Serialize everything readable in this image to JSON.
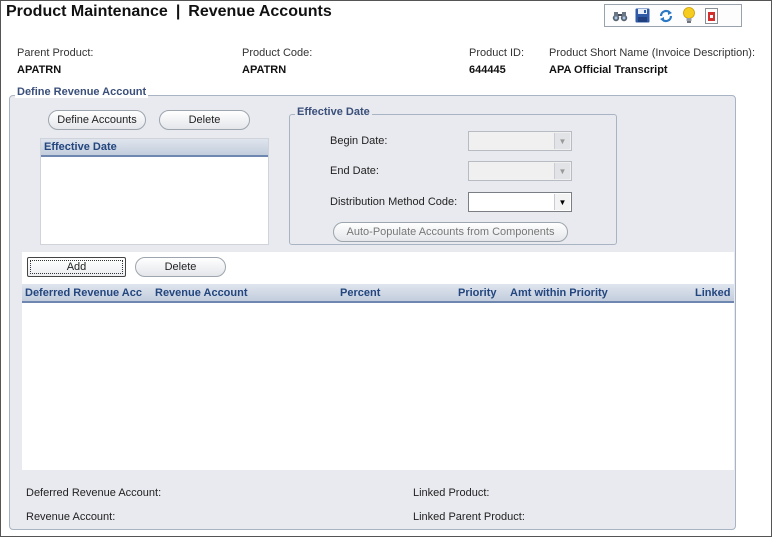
{
  "header": {
    "title_left": "Product Maintenance",
    "title_sep": "|",
    "title_right": "Revenue Accounts",
    "toolbar_icons": [
      "binoculars-icon",
      "save-icon",
      "refresh-icon",
      "lightbulb-icon",
      "report-icon"
    ]
  },
  "product_info": {
    "parent_product_label": "Parent Product:",
    "parent_product_value": "APATRN",
    "product_code_label": "Product Code:",
    "product_code_value": "APATRN",
    "product_id_label": "Product ID:",
    "product_id_value": "644445",
    "short_name_label": "Product Short Name (Invoice Description):",
    "short_name_value": "APA Official Transcript"
  },
  "define_section": {
    "legend": "Define Revenue Account",
    "define_accounts_button": "Define Accounts",
    "delete_button": "Delete",
    "effective_date_column": "Effective Date"
  },
  "effective_date_box": {
    "legend": "Effective Date",
    "begin_date_label": "Begin Date:",
    "end_date_label": "End Date:",
    "distribution_label": "Distribution Method Code:",
    "auto_populate_button": "Auto-Populate Accounts from Components"
  },
  "accounts_grid": {
    "add_button": "Add",
    "delete_button": "Delete",
    "columns": {
      "deferred": "Deferred Revenue Acc",
      "revenue": "Revenue Account",
      "percent": "Percent",
      "priority": "Priority",
      "amt": "Amt within Priority",
      "linked": "Linked"
    }
  },
  "footer": {
    "deferred_label": "Deferred Revenue Account:",
    "revenue_label": "Revenue Account:",
    "linked_product_label": "Linked Product:",
    "linked_parent_label": "Linked Parent Product:"
  }
}
